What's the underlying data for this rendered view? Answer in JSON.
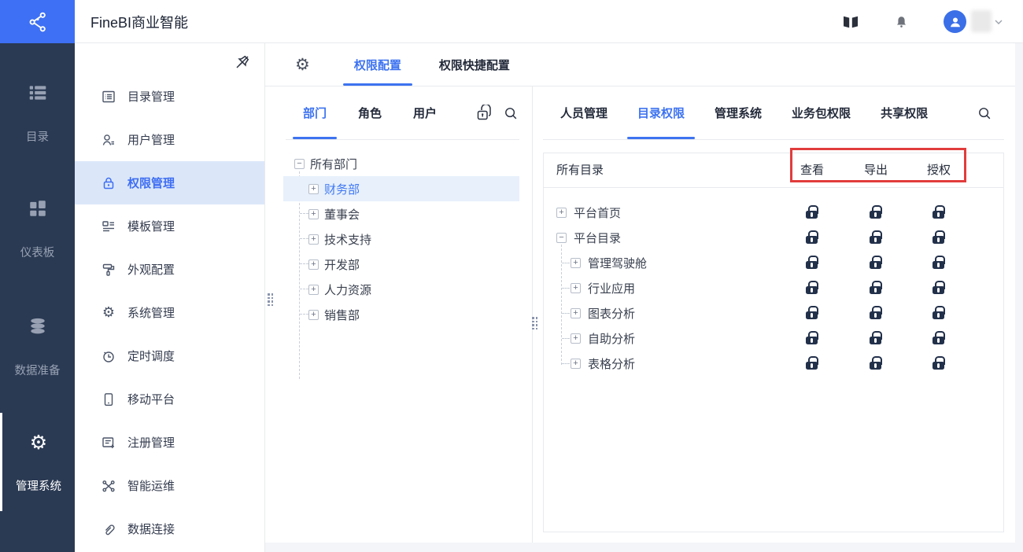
{
  "colors": {
    "accent": "#3d73f0",
    "logo_bg": "#3d70f4",
    "rail_bg": "#2b3a53",
    "annotation_red": "#e23c3c",
    "lock": "#22304a",
    "active_item_bg": "#dbe7f9"
  },
  "topbar": {
    "title": "FineBI商业智能",
    "icons": [
      "book-icon",
      "bell-icon",
      "avatar",
      "chevron-down-icon"
    ]
  },
  "nav_rail": {
    "items": [
      {
        "label": "目录",
        "icon": "list-icon",
        "active": false
      },
      {
        "label": "仪表板",
        "icon": "dashboard-icon",
        "active": false
      },
      {
        "label": "数据准备",
        "icon": "database-icon",
        "active": false
      },
      {
        "label": "管理系统",
        "icon": "gear-icon",
        "active": true
      }
    ]
  },
  "admin_menu": {
    "items": [
      {
        "label": "目录管理",
        "icon": "directory-icon",
        "active": false
      },
      {
        "label": "用户管理",
        "icon": "user-icon",
        "active": false
      },
      {
        "label": "权限管理",
        "icon": "lock-icon",
        "active": true
      },
      {
        "label": "模板管理",
        "icon": "template-icon",
        "active": false
      },
      {
        "label": "外观配置",
        "icon": "paint-roller-icon",
        "active": false
      },
      {
        "label": "系统管理",
        "icon": "gear-icon",
        "active": false
      },
      {
        "label": "定时调度",
        "icon": "clock-icon",
        "active": false
      },
      {
        "label": "移动平台",
        "icon": "mobile-icon",
        "active": false
      },
      {
        "label": "注册管理",
        "icon": "register-icon",
        "active": false
      },
      {
        "label": "智能运维",
        "icon": "ops-icon",
        "active": false
      },
      {
        "label": "数据连接",
        "icon": "link-icon",
        "active": false
      }
    ]
  },
  "main_tabs": {
    "tabs": [
      {
        "label": "权限配置",
        "active": true
      },
      {
        "label": "权限快捷配置",
        "active": false
      }
    ]
  },
  "dept_panel": {
    "tabs": [
      {
        "label": "部门",
        "active": true
      },
      {
        "label": "角色",
        "active": false
      },
      {
        "label": "用户",
        "active": false
      }
    ],
    "toolbar_icons": [
      "batch-permission-icon",
      "search-icon"
    ],
    "tree": {
      "root": "所有部门",
      "children": [
        {
          "label": "财务部",
          "selected": true
        },
        {
          "label": "董事会",
          "selected": false
        },
        {
          "label": "技术支持",
          "selected": false
        },
        {
          "label": "开发部",
          "selected": false
        },
        {
          "label": "人力资源",
          "selected": false
        },
        {
          "label": "销售部",
          "selected": false
        }
      ]
    }
  },
  "perm_panel": {
    "tabs": [
      {
        "label": "人员管理",
        "active": false
      },
      {
        "label": "目录权限",
        "active": true
      },
      {
        "label": "管理系统",
        "active": false
      },
      {
        "label": "业务包权限",
        "active": false
      },
      {
        "label": "共享权限",
        "active": false
      }
    ],
    "table": {
      "title": "所有目录",
      "columns": [
        "查看",
        "导出",
        "授权"
      ],
      "rows": [
        {
          "label": "平台首页",
          "level": 0,
          "expand": "plus",
          "locks": [
            "locked",
            "locked",
            "locked"
          ]
        },
        {
          "label": "平台目录",
          "level": 0,
          "expand": "minus",
          "locks": [
            "locked",
            "locked",
            "locked"
          ]
        },
        {
          "label": "管理驾驶舱",
          "level": 1,
          "expand": "plus",
          "locks": [
            "locked",
            "locked",
            "locked"
          ]
        },
        {
          "label": "行业应用",
          "level": 1,
          "expand": "plus",
          "locks": [
            "locked",
            "locked",
            "locked"
          ]
        },
        {
          "label": "图表分析",
          "level": 1,
          "expand": "plus",
          "locks": [
            "locked",
            "locked",
            "locked"
          ]
        },
        {
          "label": "自助分析",
          "level": 1,
          "expand": "plus",
          "locks": [
            "locked",
            "locked",
            "locked"
          ]
        },
        {
          "label": "表格分析",
          "level": 1,
          "expand": "plus",
          "locks": [
            "locked",
            "locked",
            "locked"
          ]
        }
      ]
    }
  }
}
